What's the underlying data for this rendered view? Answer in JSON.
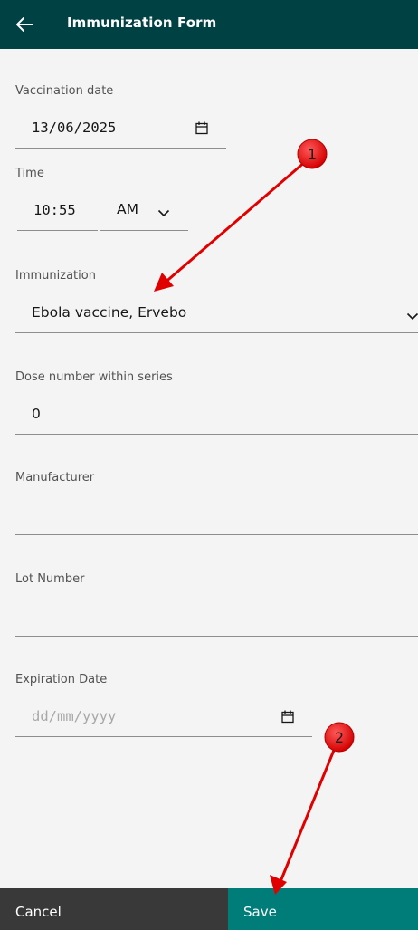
{
  "header": {
    "title": "Immunization Form"
  },
  "form": {
    "vaccination_date": {
      "label": "Vaccination date",
      "value": "13/06/2025"
    },
    "time": {
      "label": "Time",
      "value": "10:55",
      "period": "AM"
    },
    "immunization": {
      "label": "Immunization",
      "value": "Ebola vaccine, Ervebo"
    },
    "dose": {
      "label": "Dose number within series",
      "value": "0"
    },
    "manufacturer": {
      "label": "Manufacturer",
      "value": ""
    },
    "lot": {
      "label": "Lot Number",
      "value": ""
    },
    "expiration": {
      "label": "Expiration Date",
      "placeholder": "dd/mm/yyyy"
    }
  },
  "footer": {
    "cancel_label": "Cancel",
    "save_label": "Save"
  },
  "annotations": {
    "marker1": "1",
    "marker2": "2"
  },
  "colors": {
    "header_bg": "#004144",
    "save_bg": "#007d79",
    "cancel_bg": "#393939",
    "marker": "#e00000"
  }
}
